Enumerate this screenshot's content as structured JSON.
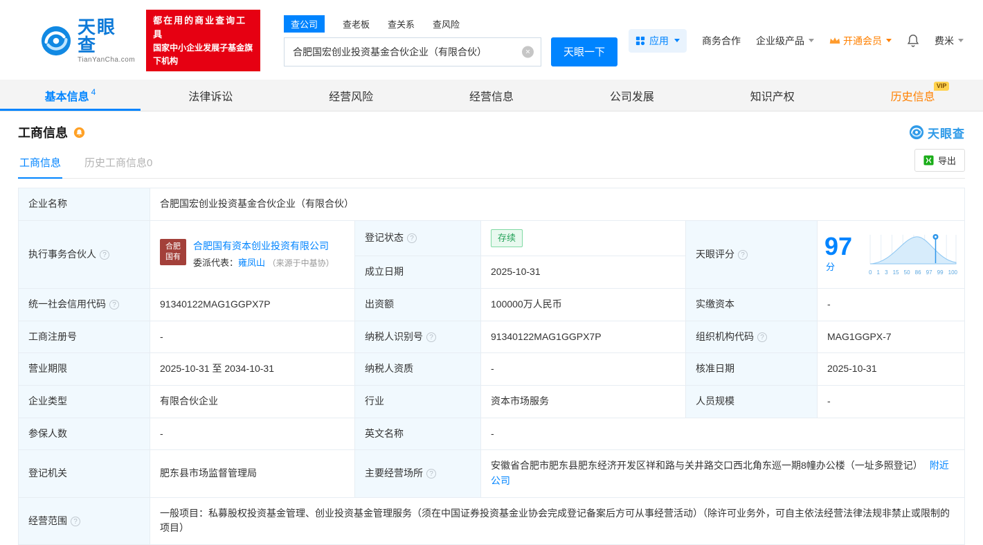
{
  "colors": {
    "primary": "#0084ff",
    "brand_red": "#e60012",
    "vip_orange": "#ff8000",
    "status_green": "#26a35a"
  },
  "header": {
    "logo": {
      "title": "天眼查",
      "subtitle": "TianYanCha.com"
    },
    "slogan": {
      "line1": "都在用的商业查询工具",
      "line2": "国家中小企业发展子基金旗下机构"
    },
    "search": {
      "tabs": [
        {
          "label": "查公司"
        },
        {
          "label": "查老板"
        },
        {
          "label": "查关系"
        },
        {
          "label": "查风险"
        }
      ],
      "value": "合肥国宏创业投资基金合伙企业（有限合伙）",
      "clear": "×",
      "button": "天眼一下"
    },
    "nav": {
      "app": "应用",
      "cooperation": "商务合作",
      "enterprise": "企业级产品",
      "vip": "开通会员",
      "user": "费米"
    }
  },
  "tabs": {
    "items": [
      {
        "label": "基本信息",
        "count": "4"
      },
      {
        "label": "法律诉讼"
      },
      {
        "label": "经营风险"
      },
      {
        "label": "经营信息"
      },
      {
        "label": "公司发展"
      },
      {
        "label": "知识产权"
      },
      {
        "label": "历史信息",
        "vip": "VIP"
      }
    ]
  },
  "section": {
    "title": "工商信息",
    "brand": "天眼查",
    "subtabs": [
      {
        "label": "工商信息"
      },
      {
        "label": "历史工商信息0"
      }
    ],
    "export": "导出"
  },
  "score": {
    "value": "97",
    "unit": "分",
    "axis": [
      "0",
      "1",
      "3",
      "15",
      "50",
      "86",
      "97",
      "99",
      "100"
    ]
  },
  "info": {
    "company_name_label": "企业名称",
    "company_name": "合肥国宏创业投资基金合伙企业（有限合伙）",
    "executive_partner_label": "执行事务合伙人",
    "partner_logo_line1": "合肥",
    "partner_logo_line2": "国有",
    "executive_partner": "合肥国有资本创业投资有限公司",
    "delegate_label": "委派代表：",
    "delegate_name": "雍凤山",
    "delegate_source": "（来源于中基协）",
    "reg_status_label": "登记状态",
    "reg_status": "存续",
    "establish_date_label": "成立日期",
    "establish_date": "2025-10-31",
    "score_label": "天眼评分",
    "credit_code_label": "统一社会信用代码",
    "credit_code": "91340122MAG1GGPX7P",
    "capital_label": "出资额",
    "capital": "100000万人民币",
    "paid_capital_label": "实缴资本",
    "paid_capital": "-",
    "reg_number_label": "工商注册号",
    "reg_number": "-",
    "taxpayer_id_label": "纳税人识别号",
    "taxpayer_id": "91340122MAG1GGPX7P",
    "org_code_label": "组织机构代码",
    "org_code": "MAG1GGPX-7",
    "business_term_label": "营业期限",
    "business_term": "2025-10-31 至 2034-10-31",
    "taxpayer_quality_label": "纳税人资质",
    "taxpayer_quality": "-",
    "approval_date_label": "核准日期",
    "approval_date": "2025-10-31",
    "company_type_label": "企业类型",
    "company_type": "有限合伙企业",
    "industry_label": "行业",
    "industry": "资本市场服务",
    "staff_size_label": "人员规模",
    "staff_size": "-",
    "insured_label": "参保人数",
    "insured": "-",
    "english_name_label": "英文名称",
    "english_name": "-",
    "reg_authority_label": "登记机关",
    "reg_authority": "肥东县市场监督管理局",
    "address_label": "主要经营场所",
    "address": "安徽省合肥市肥东县肥东经济开发区祥和路与关井路交口西北角东巡一期8幢办公楼（一址多照登记）",
    "nearby_link": "附近公司",
    "scope_label": "经营范围",
    "scope": "一般项目：私募股权投资基金管理、创业投资基金管理服务（须在中国证券投资基金业协会完成登记备案后方可从事经营活动）（除许可业务外，可自主依法经营法律法规非禁止或限制的项目）"
  }
}
